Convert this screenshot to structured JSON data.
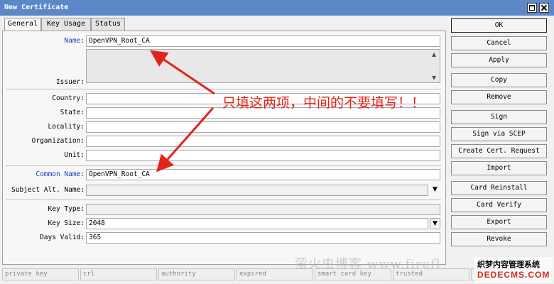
{
  "window": {
    "title": "New Certificate"
  },
  "tabs": [
    "General",
    "Key Usage",
    "Status"
  ],
  "fields": {
    "name": {
      "label": "Name:",
      "value": "OpenVPN_Root_CA"
    },
    "issuer": {
      "label": "Issuer:"
    },
    "country": {
      "label": "Country:",
      "value": ""
    },
    "state": {
      "label": "State:",
      "value": ""
    },
    "locality": {
      "label": "Locality:",
      "value": ""
    },
    "organization": {
      "label": "Organization:",
      "value": ""
    },
    "unit": {
      "label": "Unit:",
      "value": ""
    },
    "common_name": {
      "label": "Common Name:",
      "value": "OpenVPN_Root_CA"
    },
    "subject_alt_name": {
      "label": "Subject Alt. Name:",
      "value": ""
    },
    "key_type": {
      "label": "Key Type:",
      "value": ""
    },
    "key_size": {
      "label": "Key Size:",
      "value": "2048"
    },
    "days_valid": {
      "label": "Days Valid:",
      "value": "365"
    }
  },
  "buttons": [
    "OK",
    "Cancel",
    "Apply",
    "Copy",
    "Remove",
    "Sign",
    "Sign via SCEP",
    "Create Cert. Request",
    "Import",
    "Card Reinstall",
    "Card Verify",
    "Export",
    "Revoke"
  ],
  "status": [
    "private key",
    "crl",
    "authority",
    "expired",
    "smart card key",
    "trusted"
  ],
  "annotation": "只填这两项，中间的不要填写！！",
  "watermark": "萤火虫博客 www.firefl",
  "logo": {
    "line1": "织梦内容管理系统",
    "line2": "DEDECMS.COM"
  },
  "colors": {
    "titlebar": "#5c88c8",
    "label_blue": "#1a3fc0",
    "annotation_red": "#e1251b"
  },
  "icons": {
    "dropdown": "chevron-down-icon",
    "close": "close-icon",
    "maximize": "maximize-icon"
  }
}
